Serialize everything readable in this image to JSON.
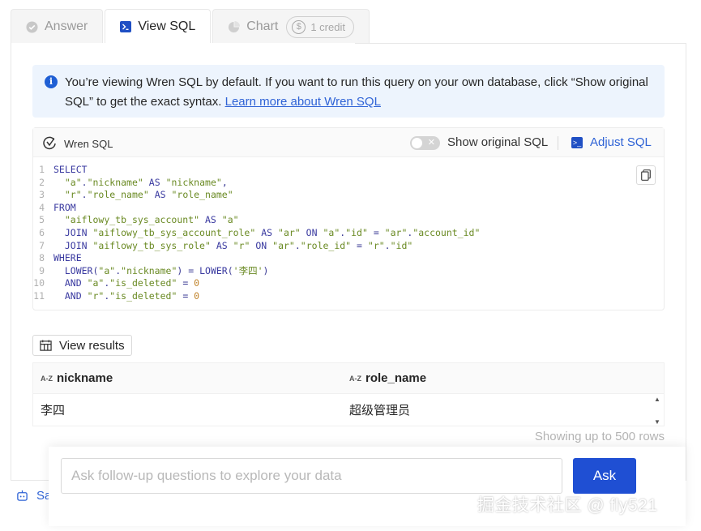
{
  "tabs": [
    {
      "label": "Answer",
      "icon": "check-circle-icon"
    },
    {
      "label": "View SQL",
      "icon": "terminal-icon"
    },
    {
      "label": "Chart",
      "icon": "pie-chart-icon",
      "credit": "1 credit",
      "credit_symbol": "$"
    }
  ],
  "alert": {
    "icon": "info-icon",
    "text": "You’re viewing Wren SQL by default. If you want to run this query on your own database, click “Show original SQL” to get the exact syntax. ",
    "link": "Learn more about Wren SQL"
  },
  "sql_panel": {
    "title": "Wren SQL",
    "toggle_label": "Show original SQL",
    "toggle_on": false,
    "adjust_label": "Adjust SQL",
    "lines": [
      {
        "n": "1",
        "code": "SELECT"
      },
      {
        "n": "2",
        "code": "  \"a\".\"nickname\" AS \"nickname\","
      },
      {
        "n": "3",
        "code": "  \"r\".\"role_name\" AS \"role_name\""
      },
      {
        "n": "4",
        "code": "FROM"
      },
      {
        "n": "5",
        "code": "  \"aiflowy_tb_sys_account\" AS \"a\""
      },
      {
        "n": "6",
        "code": "  JOIN \"aiflowy_tb_sys_account_role\" AS \"ar\" ON \"a\".\"id\" = \"ar\".\"account_id\""
      },
      {
        "n": "7",
        "code": "  JOIN \"aiflowy_tb_sys_role\" AS \"r\" ON \"ar\".\"role_id\" = \"r\".\"id\""
      },
      {
        "n": "8",
        "code": "WHERE"
      },
      {
        "n": "9",
        "code": "  LOWER(\"a\".\"nickname\") = LOWER('李四')"
      },
      {
        "n": "10",
        "code": "  AND \"a\".\"is_deleted\" = 0"
      },
      {
        "n": "11",
        "code": "  AND \"r\".\"is_deleted\" = 0"
      }
    ]
  },
  "results": {
    "button_label": "View results",
    "type_badge": "A-Z",
    "columns": [
      "nickname",
      "role_name"
    ],
    "rows": [
      [
        "李四",
        "超级管理员"
      ]
    ],
    "footer_note": "Showing up to 500 rows"
  },
  "ask": {
    "placeholder": "Ask follow-up questions to explore your data",
    "button_label": "Ask"
  },
  "save_label": "Sa",
  "watermark": "掘金技术社区 @ fly521",
  "colors": {
    "accent": "#1f4fd3",
    "link": "#2f63d6",
    "alert_bg": "#edf4fd"
  }
}
